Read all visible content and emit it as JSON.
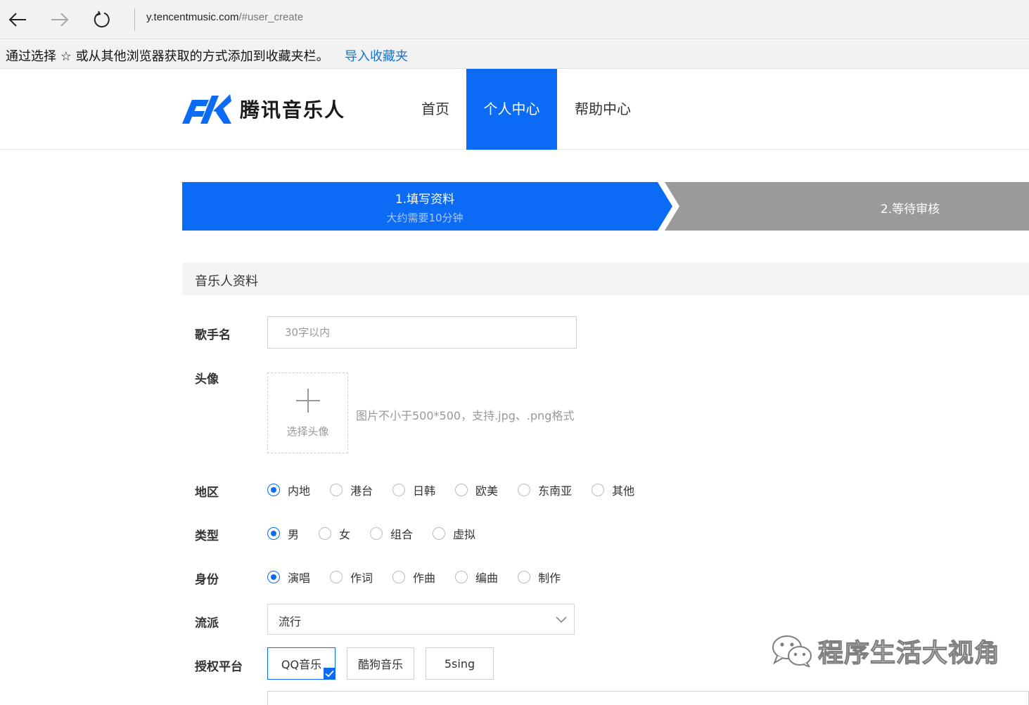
{
  "browser": {
    "url_domain": "y.tencentmusic.com",
    "url_path": "/#user_create",
    "favorites_prompt": "通过选择 ☆ 或从其他浏览器获取的方式添加到收藏夹栏。",
    "favorites_link": "导入收藏夹"
  },
  "site": {
    "logo_text": "腾讯音乐人",
    "nav": [
      {
        "label": "首页"
      },
      {
        "label": "个人中心"
      },
      {
        "label": "帮助中心"
      }
    ]
  },
  "steps": [
    {
      "title": "1.填写资料",
      "subtitle": "大约需要10分钟"
    },
    {
      "title": "2.等待审核"
    }
  ],
  "colors": {
    "primary": "#0c6bf5",
    "step_inactive": "#9a9a9a"
  },
  "form": {
    "section_title": "音乐人资料",
    "singer_name": {
      "label": "歌手名",
      "placeholder": "30字以内",
      "value": ""
    },
    "avatar": {
      "label": "头像",
      "button": "选择头像",
      "hint": "图片不小于500*500，支持.jpg、.png格式"
    },
    "region": {
      "label": "地区",
      "options": [
        "内地",
        "港台",
        "日韩",
        "欧美",
        "东南亚",
        "其他"
      ],
      "selected": "内地"
    },
    "type": {
      "label": "类型",
      "options": [
        "男",
        "女",
        "组合",
        "虚拟"
      ],
      "selected": "男"
    },
    "identity": {
      "label": "身份",
      "options": [
        "演唱",
        "作词",
        "作曲",
        "编曲",
        "制作"
      ],
      "selected": "演唱"
    },
    "genre": {
      "label": "流派",
      "value": "流行"
    },
    "platform": {
      "label": "授权平台",
      "options": [
        "QQ音乐",
        "酷狗音乐",
        "5sing"
      ],
      "selected": "QQ音乐"
    }
  },
  "watermark": "程序生活大视角"
}
